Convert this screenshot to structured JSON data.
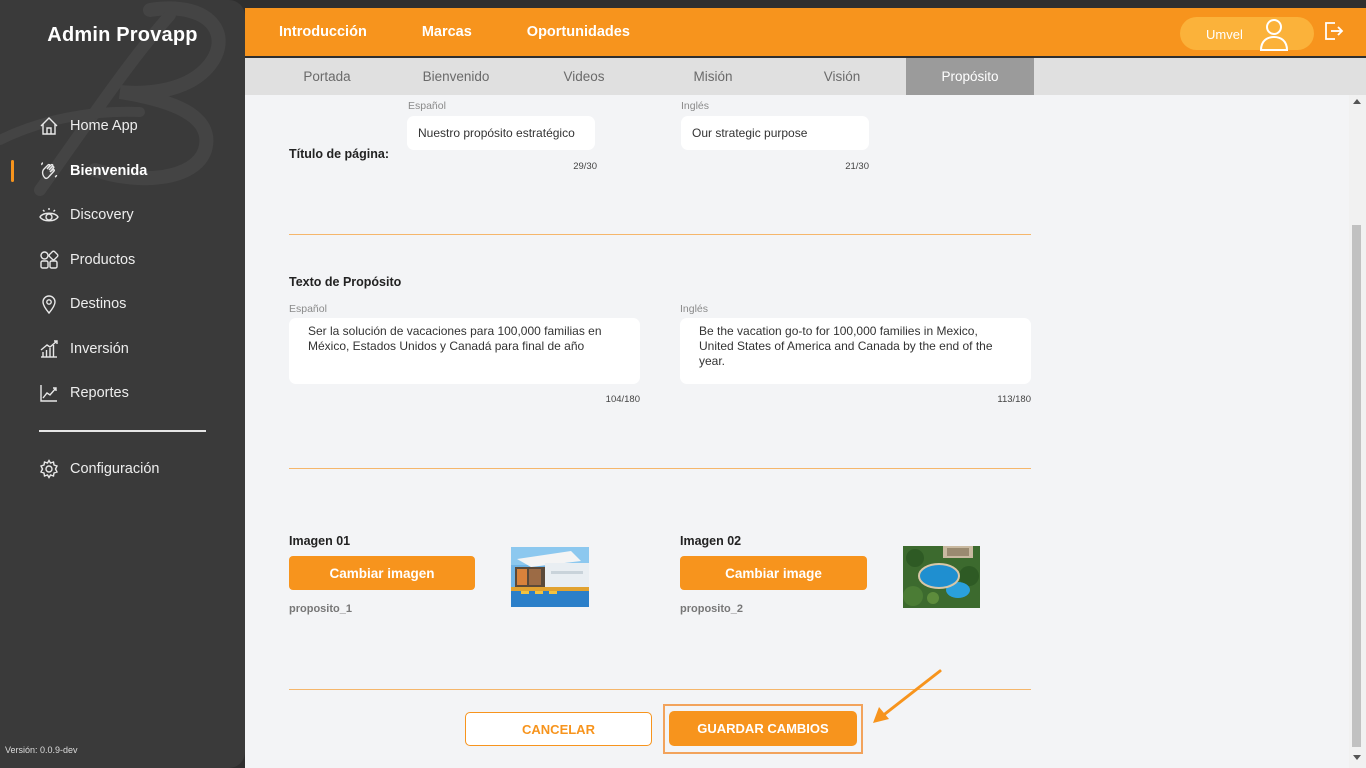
{
  "sidebar": {
    "brand": "Admin Provapp",
    "items": [
      {
        "label": "Home App",
        "icon": "home-icon"
      },
      {
        "label": "Bienvenida",
        "icon": "waving-hand-icon",
        "active": true
      },
      {
        "label": "Discovery",
        "icon": "eye-icon"
      },
      {
        "label": "Productos",
        "icon": "grid-shapes-icon"
      },
      {
        "label": "Destinos",
        "icon": "location-pin-icon"
      },
      {
        "label": "Inversión",
        "icon": "bar-growth-icon"
      },
      {
        "label": "Reportes",
        "icon": "line-chart-icon"
      }
    ],
    "config": {
      "label": "Configuración",
      "icon": "gear-icon"
    },
    "version": "Versión: 0.0.9-dev"
  },
  "topnav": {
    "items": [
      "Introducción",
      "Marcas",
      "Oportunidades"
    ],
    "user": "Umvel"
  },
  "subtabs": {
    "items": [
      "Portada",
      "Bienvenido",
      "Videos",
      "Misión",
      "Visión",
      "Propósito"
    ],
    "active_index": 5
  },
  "form": {
    "title_section": {
      "label": "Título de página:",
      "es_label": "Español",
      "en_label": "Inglés",
      "es_value": "Nuestro propósito estratégico",
      "en_value": "Our strategic purpose",
      "es_count": "29/30",
      "en_count": "21/30"
    },
    "text_section": {
      "label": "Texto de Propósito",
      "es_label": "Español",
      "en_label": "Inglés",
      "es_value": "Ser la solución de vacaciones para 100,000 familias en México, Estados Unidos y Canadá para final de año",
      "en_value": "Be the vacation go-to for 100,000 families in Mexico, United States of America and Canada by the end of the year.",
      "es_count": "104/180",
      "en_count": "113/180"
    },
    "images": [
      {
        "label": "Imagen 01",
        "button": "Cambiar imagen",
        "file": "proposito_1"
      },
      {
        "label": "Imagen 02",
        "button": "Cambiar image",
        "file": "proposito_2"
      }
    ],
    "cancel_label": "CANCELAR",
    "save_label": "GUARDAR CAMBIOS"
  },
  "colors": {
    "accent": "#f7941d",
    "sidebar_bg": "#3a3a3a",
    "content_bg": "#f3f4f6"
  }
}
